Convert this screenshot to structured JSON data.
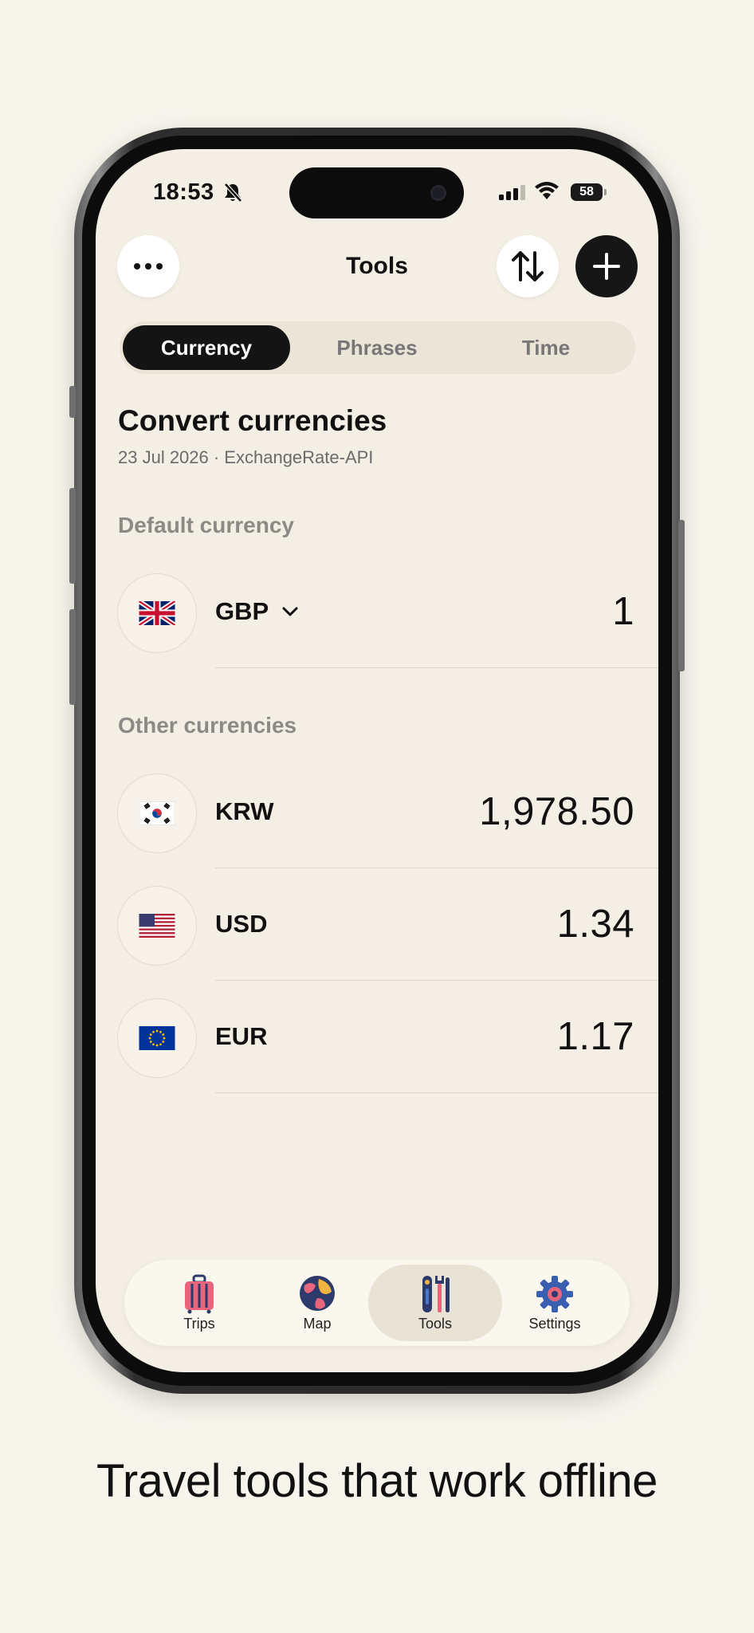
{
  "status_bar": {
    "time": "18:53",
    "battery": "58",
    "battery_level": 0.58,
    "icons": [
      "bell-slash-icon",
      "cellular-signal-icon",
      "wifi-icon",
      "battery-icon"
    ]
  },
  "nav": {
    "title": "Tools",
    "more_icon": "ellipsis-icon",
    "swap_icon": "swap-vertical-arrows-icon",
    "add_icon": "plus-icon"
  },
  "segments": {
    "items": [
      "Currency",
      "Phrases",
      "Time"
    ],
    "selected": "Currency"
  },
  "header": {
    "title": "Convert currencies",
    "subtitle": "23 Jul 2026 · ExchangeRate-API"
  },
  "default_section": {
    "label": "Default currency",
    "currency": {
      "code": "GBP",
      "flag": "uk-flag-icon",
      "value": "1"
    }
  },
  "other_section": {
    "label": "Other currencies",
    "currencies": [
      {
        "code": "KRW",
        "flag": "south-korea-flag-icon",
        "value": "1,978.50"
      },
      {
        "code": "USD",
        "flag": "us-flag-icon",
        "value": "1.34"
      },
      {
        "code": "EUR",
        "flag": "eu-flag-icon",
        "value": "1.17"
      }
    ]
  },
  "tabbar": {
    "items": [
      {
        "label": "Trips",
        "icon": "suitcase-icon"
      },
      {
        "label": "Map",
        "icon": "globe-icon"
      },
      {
        "label": "Tools",
        "icon": "tools-icon"
      },
      {
        "label": "Settings",
        "icon": "gear-icon"
      }
    ],
    "selected": "Tools"
  },
  "caption": "Travel tools that work offline",
  "colors": {
    "background": "#f7f4ec",
    "screen": "#f4efe4",
    "accent_dark": "#141414",
    "muted_text": "#8c8a85"
  }
}
